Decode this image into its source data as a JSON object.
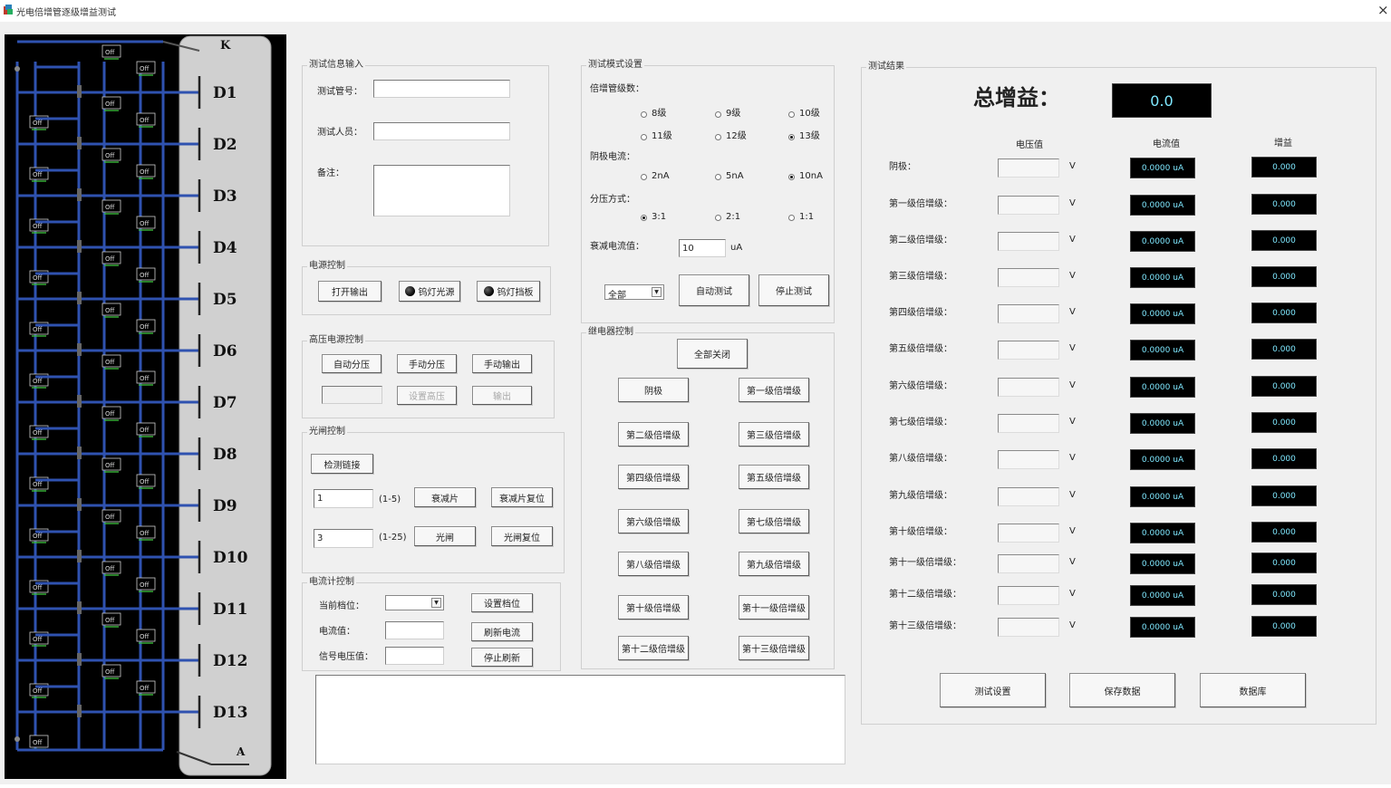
{
  "window": {
    "title": "光电倍增管逐级增益测试",
    "close": "×"
  },
  "schematic": {
    "top_label": "K",
    "bottom_label": "A",
    "dynodes": [
      "D1",
      "D2",
      "D3",
      "D4",
      "D5",
      "D6",
      "D7",
      "D8",
      "D9",
      "D10",
      "D11",
      "D12",
      "D13"
    ],
    "switch_label": "Off"
  },
  "info": {
    "title": "测试信息输入",
    "tube_no_label": "测试管号：",
    "tester_label": "测试人员：",
    "remark_label": "备注：",
    "tube_no_value": "",
    "tester_value": "",
    "remark_value": ""
  },
  "power": {
    "title": "电源控制",
    "open_output": "打开输出",
    "lamp_source": "钨灯光源",
    "lamp_shutter": "钨灯挡板"
  },
  "hv": {
    "title": "高压电源控制",
    "auto_divide": "自动分压",
    "manual_divide": "手动分压",
    "manual_output": "手动输出",
    "set_hv": "设置高压",
    "output": "输出",
    "hv_value": ""
  },
  "shutter": {
    "title": "光闸控制",
    "detect_link": "检测链接",
    "atten_value": "1",
    "atten_range": "(1-5)",
    "atten_btn": "衰减片",
    "atten_reset": "衰减片复位",
    "gate_value": "3",
    "gate_range": "(1-25)",
    "gate_btn": "光闸",
    "gate_reset": "光闸复位"
  },
  "ammeter": {
    "title": "电流计控制",
    "range_label": "当前档位：",
    "current_label": "电流值：",
    "signal_label": "信号电压值：",
    "range_value": "",
    "current_value": "",
    "signal_value": "",
    "set_range": "设置档位",
    "refresh": "刷新电流",
    "stop_refresh": "停止刷新"
  },
  "mode": {
    "title": "测试模式设置",
    "stages_label": "倍增管级数：",
    "stages": [
      {
        "label": "8级",
        "selected": false
      },
      {
        "label": "9级",
        "selected": false
      },
      {
        "label": "10级",
        "selected": false
      },
      {
        "label": "11级",
        "selected": false
      },
      {
        "label": "12级",
        "selected": false
      },
      {
        "label": "13级",
        "selected": true
      }
    ],
    "cathode_label": "阴极电流：",
    "cathode": [
      {
        "label": "2nA",
        "selected": false
      },
      {
        "label": "5nA",
        "selected": false
      },
      {
        "label": "10nA",
        "selected": true
      }
    ],
    "divider_label": "分压方式：",
    "divider": [
      {
        "label": "3:1",
        "selected": true
      },
      {
        "label": "2:1",
        "selected": false
      },
      {
        "label": "1:1",
        "selected": false
      }
    ],
    "decay_label": "衰减电流值：",
    "decay_value": "10",
    "decay_unit": "uA",
    "scope_value": "全部",
    "auto_test": "自动测试",
    "stop_test": "停止测试"
  },
  "relay": {
    "title": "继电器控制",
    "all_off": "全部关闭",
    "buttons": [
      "阴极",
      "第一级倍增级",
      "第二级倍增级",
      "第三级倍增级",
      "第四级倍增级",
      "第五级倍增级",
      "第六级倍增级",
      "第七级倍增级",
      "第八级倍增级",
      "第九级倍增级",
      "第十级倍增级",
      "第十一级倍增级",
      "第十二级倍增级",
      "第十三级倍增级"
    ]
  },
  "log": {
    "text": ""
  },
  "results": {
    "title": "测试结果",
    "total_gain_label": "总增益：",
    "total_gain_value": "0.0",
    "col_voltage": "电压值",
    "col_current": "电流值",
    "col_gain": "增益",
    "volt_unit": "V",
    "rows": [
      {
        "label": "阴极：",
        "current": "0.0000 uA",
        "gain": "0.000"
      },
      {
        "label": "第一级倍增级：",
        "current": "0.0000 uA",
        "gain": "0.000"
      },
      {
        "label": "第二级倍增级：",
        "current": "0.0000 uA",
        "gain": "0.000"
      },
      {
        "label": "第三级倍增级：",
        "current": "0.0000 uA",
        "gain": "0.000"
      },
      {
        "label": "第四级倍增级：",
        "current": "0.0000 uA",
        "gain": "0.000"
      },
      {
        "label": "第五级倍增级：",
        "current": "0.0000 uA",
        "gain": "0.000"
      },
      {
        "label": "第六级倍增级：",
        "current": "0.0000 uA",
        "gain": "0.000"
      },
      {
        "label": "第七级倍增级：",
        "current": "0.0000 uA",
        "gain": "0.000"
      },
      {
        "label": "第八级倍增级：",
        "current": "0.0000 uA",
        "gain": "0.000"
      },
      {
        "label": "第九级倍增级：",
        "current": "0.0000 uA",
        "gain": "0.000"
      },
      {
        "label": "第十级倍增级：",
        "current": "0.0000 uA",
        "gain": "0.000"
      },
      {
        "label": "第十一级倍增级：",
        "current": "0.0000 uA",
        "gain": "0.000"
      },
      {
        "label": "第十二级倍增级：",
        "current": "0.0000 uA",
        "gain": "0.000"
      },
      {
        "label": "第十三级倍增级：",
        "current": "0.0000 uA",
        "gain": "0.000"
      }
    ],
    "test_settings": "测试设置",
    "save_data": "保存数据",
    "database": "数据库"
  }
}
